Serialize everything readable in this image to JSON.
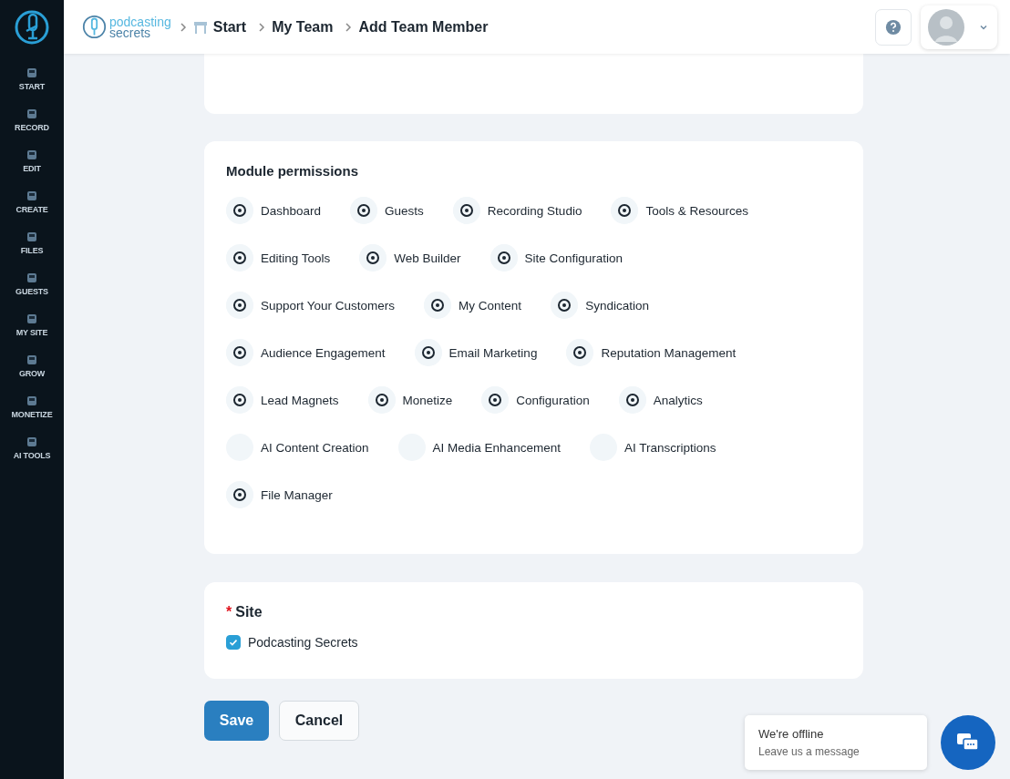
{
  "sidebar": {
    "items": [
      {
        "label": "START",
        "selected": false
      },
      {
        "label": "RECORD",
        "selected": false
      },
      {
        "label": "EDIT",
        "selected": false
      },
      {
        "label": "CREATE",
        "selected": false
      },
      {
        "label": "FILES",
        "selected": false
      },
      {
        "label": "GUESTS",
        "selected": false
      },
      {
        "label": "MY SITE",
        "selected": false
      },
      {
        "label": "GROW",
        "selected": false
      },
      {
        "label": "MONETIZE",
        "selected": false
      },
      {
        "label": "AI TOOLS",
        "selected": false
      }
    ]
  },
  "header": {
    "logo": {
      "line_1": "podcasting",
      "line_2": "secrets"
    },
    "breadcrumbs": [
      "Start",
      "My Team",
      "Add Team Member"
    ]
  },
  "module_permissions": {
    "title": "Module permissions",
    "rows": [
      [
        {
          "label": "Dashboard",
          "kind": "icon"
        },
        {
          "label": "Guests",
          "kind": "icon"
        },
        {
          "label": "Recording Studio",
          "kind": "icon"
        },
        {
          "label": "Tools & Resources",
          "kind": "icon"
        }
      ],
      [
        {
          "label": "Editing Tools",
          "kind": "icon"
        },
        {
          "label": "Web Builder",
          "kind": "icon"
        },
        {
          "label": "Site Configuration",
          "kind": "icon"
        }
      ],
      [
        {
          "label": "Support Your Customers",
          "kind": "icon"
        },
        {
          "label": "My Content",
          "kind": "icon"
        },
        {
          "label": "Syndication",
          "kind": "icon"
        }
      ],
      [
        {
          "label": "Audience Engagement",
          "kind": "icon"
        },
        {
          "label": "Email Marketing",
          "kind": "icon"
        },
        {
          "label": "Reputation Management",
          "kind": "icon"
        }
      ],
      [
        {
          "label": "Lead Magnets",
          "kind": "icon"
        },
        {
          "label": "Monetize",
          "kind": "icon"
        },
        {
          "label": "Configuration",
          "kind": "icon"
        },
        {
          "label": "Analytics",
          "kind": "icon"
        }
      ],
      [
        {
          "label": "AI Content Creation",
          "kind": "blank"
        },
        {
          "label": "AI Media Enhancement",
          "kind": "blank"
        },
        {
          "label": "AI Transcriptions",
          "kind": "blank"
        }
      ],
      [
        {
          "label": "File Manager",
          "kind": "icon"
        }
      ]
    ]
  },
  "site": {
    "title": "Site",
    "required_mark": "*",
    "options": [
      {
        "label": "Podcasting Secrets",
        "checked": true
      }
    ]
  },
  "buttons": {
    "save": "Save",
    "cancel": "Cancel"
  },
  "chat": {
    "title": "We're offline",
    "subtitle": "Leave us a message"
  }
}
